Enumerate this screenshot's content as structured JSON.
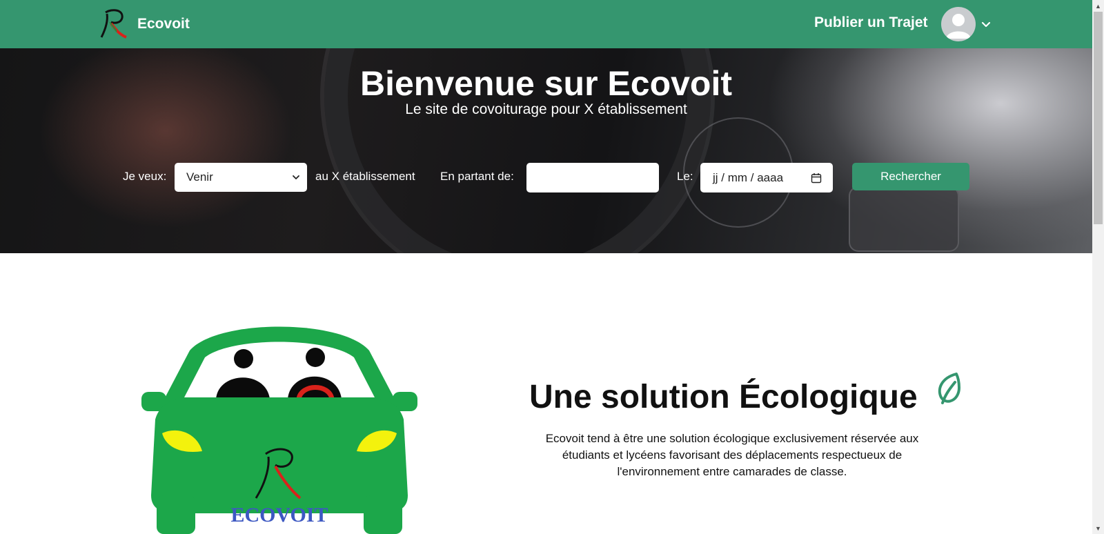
{
  "navbar": {
    "brand_name": "Ecovoit",
    "publish_label": "Publier un Trajet",
    "background_color": "#35966f"
  },
  "hero": {
    "title": "Bienvenue sur Ecovoit",
    "subtitle": "Le site de covoiturage pour X établissement"
  },
  "search_form": {
    "want_label": "Je veux:",
    "direction_selected": "Venir",
    "destination_text": "au X établissement",
    "from_label": "En partant de:",
    "from_value": "",
    "date_label": "Le:",
    "date_placeholder": "jj / mm / aaaa",
    "search_button_label": "Rechercher"
  },
  "feature": {
    "headline_prefix": "Une solution",
    "headline_highlight": "Écologique",
    "description": "Ecovoit tend à être une solution écologique exclusivement réservée aux étudiants et lycéens favorisant des déplacements respectueux de l'environnement entre camarades de classe.",
    "illustration_brand_text": "ECOVOIT",
    "accent_color": "#35966f",
    "highlight_color": "#bff0dc"
  },
  "icons": {
    "brand": "ecovoit-logo-icon",
    "avatar": "user-avatar-icon",
    "dropdown": "chevron-down-icon",
    "calendar": "calendar-icon",
    "leaf": "leaf-icon"
  }
}
